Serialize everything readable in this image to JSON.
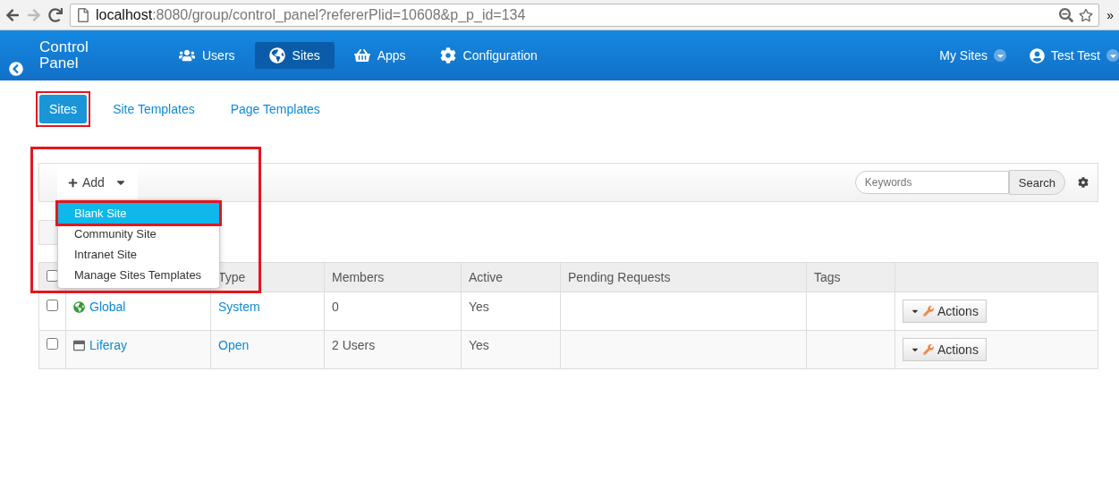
{
  "browser": {
    "url_host": "localhost",
    "url_rest": ":8080/group/control_panel?refererPlid=10608&p_p_id=134",
    "overflow": "»"
  },
  "navbar": {
    "title": "Control Panel",
    "items": [
      {
        "label": "Users",
        "selected": false
      },
      {
        "label": "Sites",
        "selected": true
      },
      {
        "label": "Apps",
        "selected": false
      },
      {
        "label": "Configuration",
        "selected": false
      }
    ],
    "right": [
      {
        "label": "My Sites",
        "kind": "menu"
      },
      {
        "label": "Test Test",
        "kind": "user"
      }
    ]
  },
  "tabs": [
    {
      "label": "Sites",
      "selected": true,
      "highlighted": true
    },
    {
      "label": "Site Templates",
      "selected": false,
      "highlighted": false
    },
    {
      "label": "Page Templates",
      "selected": false,
      "highlighted": false
    }
  ],
  "toolbar": {
    "add_label": "Add",
    "highlighted": true,
    "search_placeholder": "Keywords",
    "search_button": "Search"
  },
  "add_menu": {
    "items": [
      {
        "label": "Blank Site",
        "selected": true
      },
      {
        "label": "Community Site",
        "selected": false
      },
      {
        "label": "Intranet Site",
        "selected": false
      },
      {
        "label": "Manage Sites Templates",
        "selected": false
      }
    ]
  },
  "table": {
    "all_checked": false,
    "columns": [
      "Type",
      "Members",
      "Active",
      "Pending Requests",
      "Tags"
    ],
    "rows": [
      {
        "checked": false,
        "name": "Global",
        "type": "System",
        "members": "0",
        "active": "Yes",
        "action": "Actions"
      },
      {
        "checked": false,
        "name": "Liferay",
        "type": "Open",
        "members": "2 Users",
        "active": "Yes",
        "action": "Actions"
      }
    ]
  }
}
